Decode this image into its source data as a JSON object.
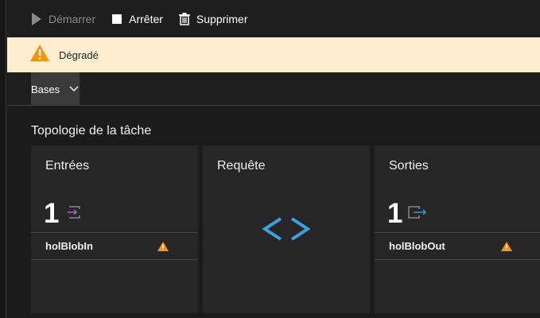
{
  "toolbar": {
    "start_label": "Démarrer",
    "stop_label": "Arrêter",
    "delete_label": "Supprimer"
  },
  "status": {
    "text": "Dégradé",
    "color_bg": "#fdeed0",
    "icon_color": "#f7930e"
  },
  "tabs": {
    "bases_label": "Bases"
  },
  "topology": {
    "title": "Topologie de la tâche",
    "inputs": {
      "title": "Entrées",
      "count": "1",
      "items": [
        {
          "name": "holBlobIn",
          "status": "warning"
        }
      ]
    },
    "query": {
      "title": "Requête",
      "symbol": "< >",
      "accent": "#3aa0e0"
    },
    "outputs": {
      "title": "Sorties",
      "count": "1",
      "items": [
        {
          "name": "holBlobOut",
          "status": "warning"
        }
      ]
    }
  }
}
